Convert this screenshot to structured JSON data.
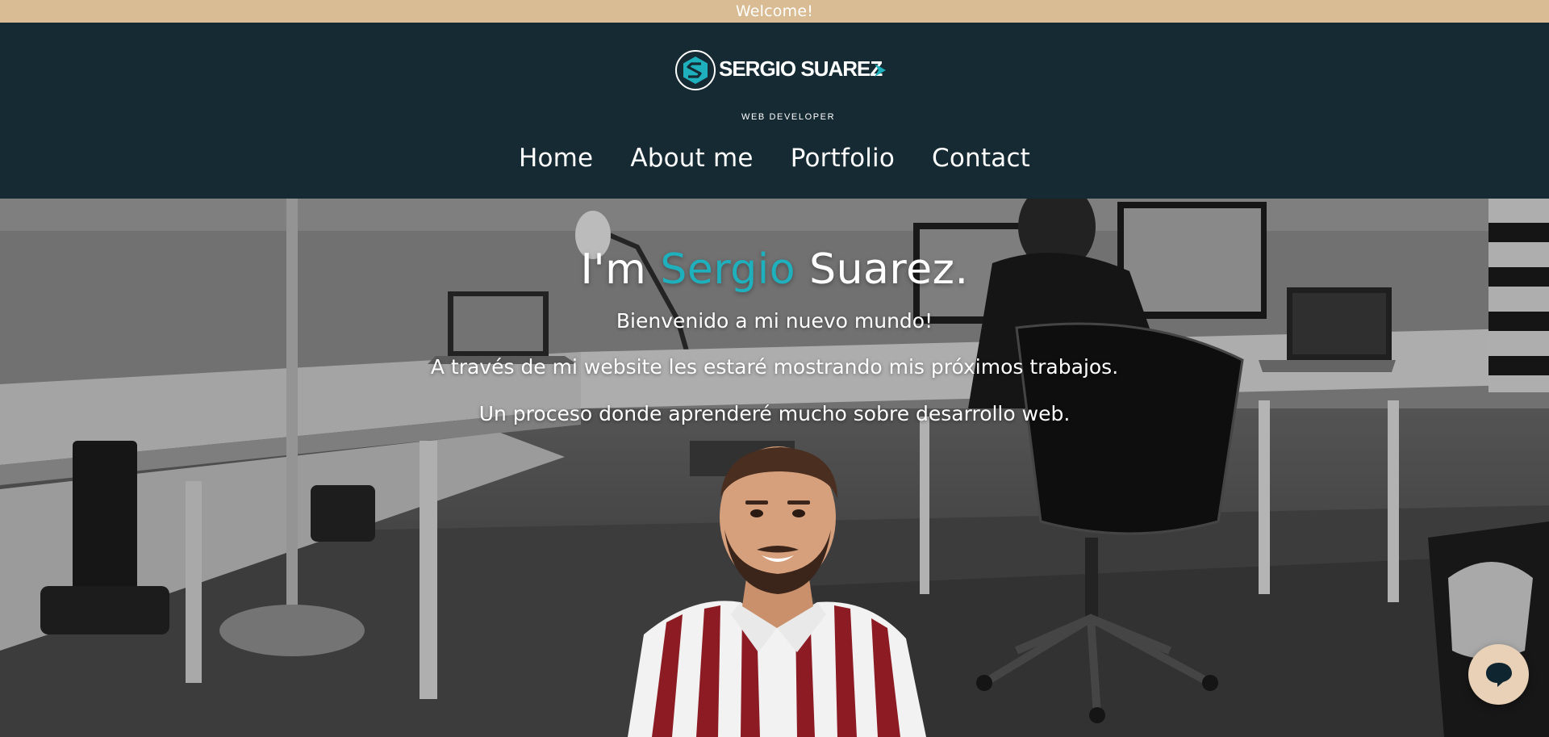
{
  "banner": {
    "text": "Welcome!"
  },
  "logo": {
    "name": "SERGIO SUAREZ",
    "subtitle": "WEB DEVELOPER"
  },
  "nav": {
    "items": [
      {
        "label": "Home"
      },
      {
        "label": "About me"
      },
      {
        "label": "Portfolio"
      },
      {
        "label": "Contact"
      }
    ]
  },
  "hero": {
    "title_prefix": "I'm",
    "title_accent": "Sergio",
    "title_suffix": "Suarez.",
    "line1": "Bienvenido a mi nuevo mundo!",
    "line2": "A través de mi website les estaré mostrando mis próximos trabajos.",
    "line3": "Un proceso donde aprenderé mucho sobre desarrollo web."
  },
  "chat": {
    "icon": "chat-bubble-icon"
  },
  "colors": {
    "banner_bg": "#d9bc94",
    "header_bg": "#162a33",
    "accent": "#1eb1bd",
    "chat_bg": "#e8d1b7"
  }
}
